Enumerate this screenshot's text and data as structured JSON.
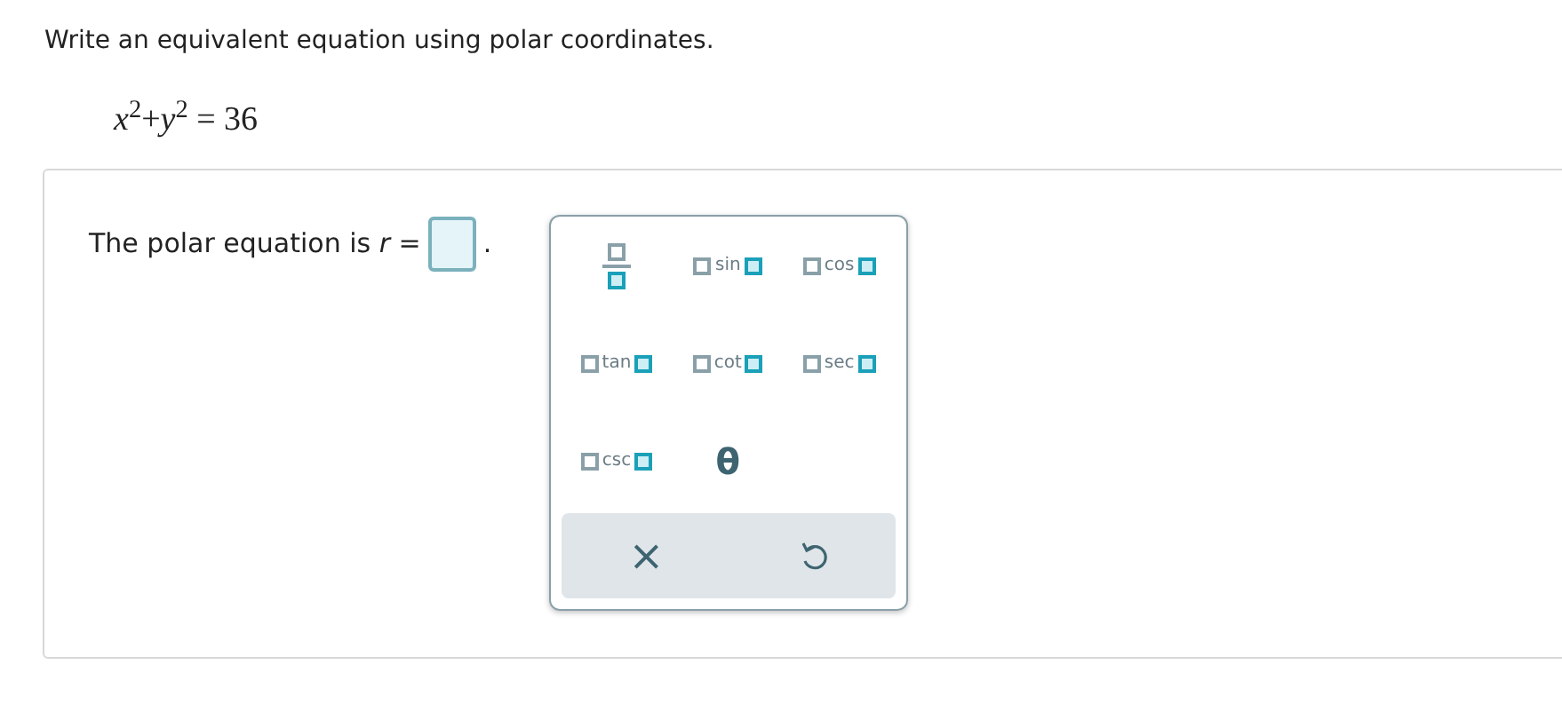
{
  "instruction": "Write an equivalent equation using polar coordinates.",
  "equation": "*x*$^{2}$+*y*$^{2}$ = 36",
  "answer": {
    "prompt": "The polar equation is *r* =",
    "end": "."
  },
  "palette": {
    "keys": [
      {
        "kind": "fraction"
      },
      {
        "kind": "func",
        "label": "sin"
      },
      {
        "kind": "func",
        "label": "cos"
      },
      {
        "kind": "func",
        "label": "tan"
      },
      {
        "kind": "func",
        "label": "cot"
      },
      {
        "kind": "func",
        "label": "sec"
      },
      {
        "kind": "func",
        "label": "csc"
      },
      {
        "kind": "symbol",
        "label": "θ"
      }
    ],
    "actions": [
      {
        "kind": "clear",
        "label": "×"
      },
      {
        "kind": "undo"
      }
    ]
  }
}
